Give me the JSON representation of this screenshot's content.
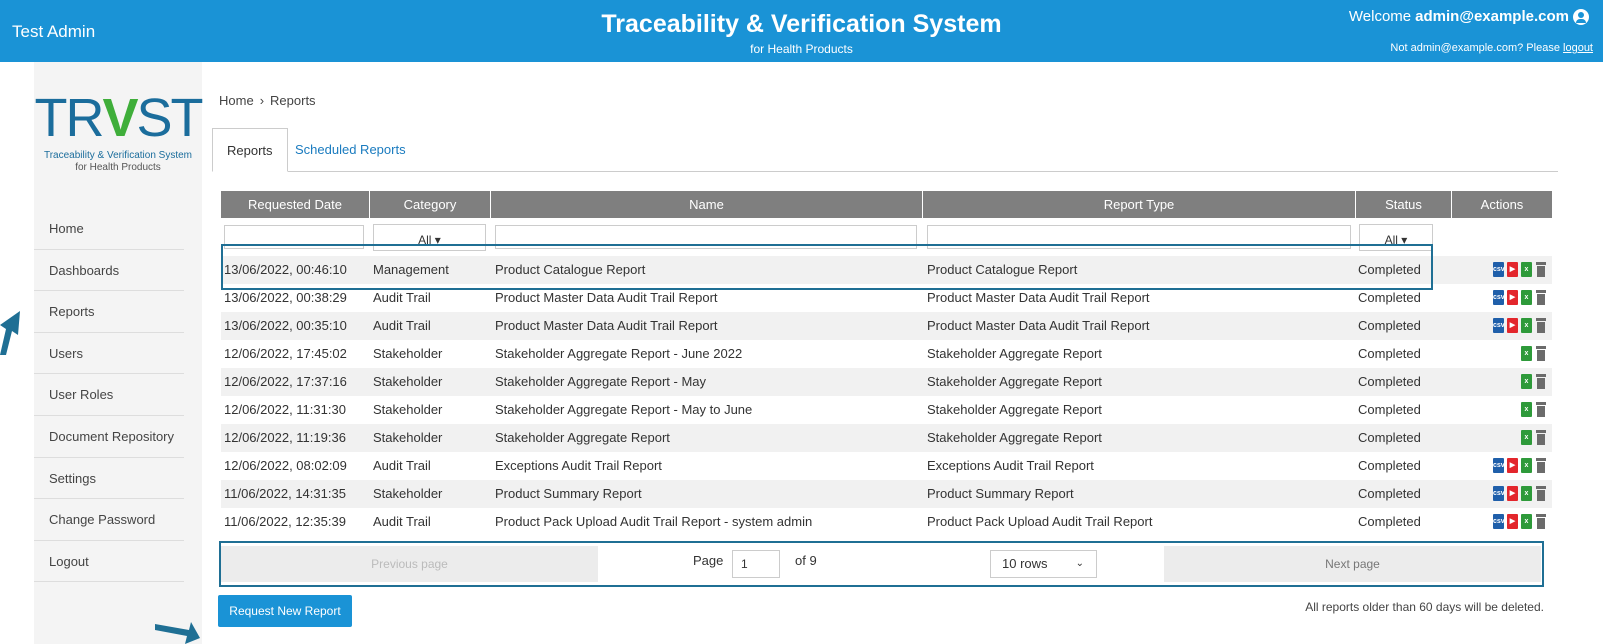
{
  "header": {
    "app_name": "Test Admin",
    "title": "Traceability & Verification System",
    "subtitle": "for Health Products",
    "welcome_prefix": "Welcome",
    "welcome_user": "admin@example.com",
    "not_user_text": "Not admin@example.com? Please",
    "logout_link": "logout"
  },
  "logo": {
    "mark_left": "TR",
    "mark_v": "V",
    "mark_right": "ST",
    "tagline1": "Traceability & Verification System",
    "tagline2": "for Health Products"
  },
  "sidebar": {
    "items": [
      {
        "label": "Home"
      },
      {
        "label": "Dashboards"
      },
      {
        "label": "Reports"
      },
      {
        "label": "Users"
      },
      {
        "label": "User Roles"
      },
      {
        "label": "Document Repository"
      },
      {
        "label": "Settings"
      },
      {
        "label": "Change Password"
      },
      {
        "label": "Logout"
      }
    ]
  },
  "breadcrumb": {
    "home": "Home",
    "separator": "›",
    "current": "Reports"
  },
  "tabs": [
    {
      "label": "Reports",
      "active": true
    },
    {
      "label": "Scheduled Reports",
      "active": false
    }
  ],
  "table": {
    "columns": [
      "Requested Date",
      "Category",
      "Name",
      "Report Type",
      "Status",
      "Actions"
    ],
    "filter_category": "All ▾",
    "filter_status": "All ▾",
    "rows": [
      {
        "date": "13/06/2022, 00:46:10",
        "category": "Management",
        "name": "Product Catalogue Report",
        "type": "Product Catalogue Report",
        "status": "Completed",
        "actions": [
          "csv",
          "pdf",
          "xls",
          "del"
        ]
      },
      {
        "date": "13/06/2022, 00:38:29",
        "category": "Audit Trail",
        "name": "Product Master Data Audit Trail Report",
        "type": "Product Master Data Audit Trail Report",
        "status": "Completed",
        "actions": [
          "csv",
          "pdf",
          "xls",
          "del"
        ]
      },
      {
        "date": "13/06/2022, 00:35:10",
        "category": "Audit Trail",
        "name": "Product Master Data Audit Trail Report",
        "type": "Product Master Data Audit Trail Report",
        "status": "Completed",
        "actions": [
          "csv",
          "pdf",
          "xls",
          "del"
        ]
      },
      {
        "date": "12/06/2022, 17:45:02",
        "category": "Stakeholder",
        "name": "Stakeholder Aggregate Report - June 2022",
        "type": "Stakeholder Aggregate Report",
        "status": "Completed",
        "actions": [
          "xls",
          "del"
        ]
      },
      {
        "date": "12/06/2022, 17:37:16",
        "category": "Stakeholder",
        "name": "Stakeholder Aggregate Report - May",
        "type": "Stakeholder Aggregate Report",
        "status": "Completed",
        "actions": [
          "xls",
          "del"
        ]
      },
      {
        "date": "12/06/2022, 11:31:30",
        "category": "Stakeholder",
        "name": "Stakeholder Aggregate Report - May to June",
        "type": "Stakeholder Aggregate Report",
        "status": "Completed",
        "actions": [
          "xls",
          "del"
        ]
      },
      {
        "date": "12/06/2022, 11:19:36",
        "category": "Stakeholder",
        "name": "Stakeholder Aggregate Report",
        "type": "Stakeholder Aggregate Report",
        "status": "Completed",
        "actions": [
          "xls",
          "del"
        ]
      },
      {
        "date": "12/06/2022, 08:02:09",
        "category": "Audit Trail",
        "name": "Exceptions Audit Trail Report",
        "type": "Exceptions Audit Trail Report",
        "status": "Completed",
        "actions": [
          "csv",
          "pdf",
          "xls",
          "del"
        ]
      },
      {
        "date": "11/06/2022, 14:31:35",
        "category": "Stakeholder",
        "name": "Product Summary Report",
        "type": "Product Summary Report",
        "status": "Completed",
        "actions": [
          "csv",
          "pdf",
          "xls",
          "del"
        ]
      },
      {
        "date": "11/06/2022, 12:35:39",
        "category": "Audit Trail",
        "name": "Product Pack Upload Audit Trail Report - system admin",
        "type": "Product Pack Upload Audit Trail Report",
        "status": "Completed",
        "actions": [
          "csv",
          "pdf",
          "xls",
          "del"
        ]
      }
    ]
  },
  "icons": {
    "csv": "csv",
    "pdf": "▶",
    "xls": "x"
  },
  "pagination": {
    "previous": "Previous page",
    "page_label": "Page",
    "current_page": "1",
    "of_total": "of 9",
    "rows_option": "10 rows",
    "next": "Next page"
  },
  "request_button": "Request New Report",
  "retention_note": "All reports older than 60 days will be deleted.",
  "colors": {
    "brand": "#1a93d6",
    "header_gray": "#7f7f7f",
    "highlight": "#1f6f94"
  }
}
